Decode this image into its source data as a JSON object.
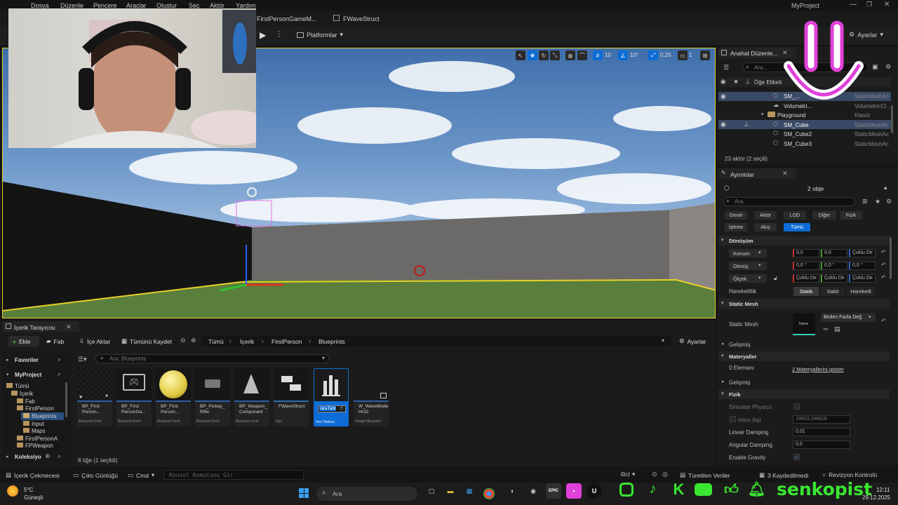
{
  "menu": [
    "Dosya",
    "Düzenle",
    "Pencere",
    "Araçlar",
    "Oluştur",
    "Seç",
    "Aktör",
    "Yardım"
  ],
  "project_name": "MyProject",
  "editor_tabs": [
    "FirstPersonGameM...",
    "FWaveStruct"
  ],
  "toolbar": {
    "platforms": "Platformlar",
    "settings": "Ayarlar"
  },
  "viewport": {
    "grid_value": "10",
    "angle_value": "10°",
    "scale_value": "0,25",
    "camera_value": "1"
  },
  "outliner": {
    "title": "Anahat Düzenle...",
    "search_placeholder": "Ara...",
    "col_label": "Öğe Etiketi",
    "rows": [
      {
        "name": "SM_...",
        "type": "StaticMeshAc"
      },
      {
        "name": "Volumetri...",
        "type": "VolumetricCl..."
      },
      {
        "name": "Playground",
        "type": "Klasör"
      },
      {
        "name": "SM_Cube",
        "type": "StaticMeshAc"
      },
      {
        "name": "SM_Cube2",
        "type": "StaticMeshAc"
      },
      {
        "name": "SM_Cube3",
        "type": "StaticMeshAc"
      }
    ],
    "status": "23 aktör (2 seçili)"
  },
  "details": {
    "title": "Ayrıntılar",
    "objects": "2 obje",
    "search_placeholder": "Ara",
    "filters_row1": [
      "Genel",
      "Aktör",
      "LOD",
      "Diğer",
      "Fizik"
    ],
    "filters_row2": [
      "İşleme",
      "Akış",
      "Tümü"
    ],
    "transform": "Dönüşüm",
    "location": "Konum",
    "rotation": "Dönüş",
    "scale": "Ölçek",
    "loc_vals": [
      "0,0",
      "0,0",
      "Çoklu De"
    ],
    "rot_vals": [
      "0,0 °",
      "0,0 °",
      "0,0 °"
    ],
    "scale_vals": [
      "Çoklu De",
      "Çoklu De",
      "Çoklu De"
    ],
    "mobility_label": "Hareketlilik",
    "mobility": [
      "Statik",
      "Sabit",
      "Hareketli"
    ],
    "static_mesh_header": "Static Mesh",
    "static_mesh_label": "Static Mesh",
    "mesh_thumb": "None",
    "mesh_value": "Birden Fazla Değ",
    "advanced1": "Gelişmiş",
    "materials_header": "Materyaller",
    "elements": "0 Elemanı",
    "show_materials": "2 Materyallerini göster",
    "advanced2": "Gelişmiş",
    "physics_header": "Fizik",
    "simulate": "Simulate Physics",
    "mass_label": "Mass (kg)",
    "mass_value": "19603,298828",
    "linear_label": "Linear Damping",
    "linear_value": "0,01",
    "angular_label": "Angular Damping",
    "angular_value": "0,0",
    "gravity_label": "Enable Gravity"
  },
  "content": {
    "tab": "İçerik Tarayıcısı",
    "add": "Ekle",
    "fab": "Fab",
    "import": "İçe Aktar",
    "save_all": "Tümünü Kaydet",
    "breadcrumb": [
      "Tümü",
      "İçerik",
      "FirstPerson",
      "Blueprints"
    ],
    "settings": "Ayarlar",
    "favorites": "Favoriler",
    "project": "MyProject",
    "search_placeholder": "Ara: Blueprints",
    "tree": [
      "Tümü",
      "İçerik",
      "Fab",
      "FirstPerson",
      "Blueprints",
      "Input",
      "Maps",
      "FirstPersonA",
      "FPWeapon"
    ],
    "collections": "Koleksiyo",
    "assets": [
      {
        "name": "BP_First Person...",
        "type": "Blueprint Sınıfı"
      },
      {
        "name": "BP_First PersonGa...",
        "type": "Blueprint Sınıfı"
      },
      {
        "name": "BP_First Person...",
        "type": "Blueprint Sınıfı"
      },
      {
        "name": "BP_Pickup_ Rifle",
        "type": "Blueprint Sınıfı"
      },
      {
        "name": "BP_Weapon_ Component",
        "type": "Blueprint Sınıfı"
      },
      {
        "name": "FWaveStruct",
        "type": "Yapı"
      },
      {
        "name": "lataTabl",
        "type": "Veri Tablosu"
      },
      {
        "name": "W_WaveMode HUD",
        "type": "Widget Blueprint"
      }
    ],
    "count": "8 öğe (1 seçildi)"
  },
  "statusbar": {
    "drawer": "İçerik Çekmecesi",
    "output": "Çıktı Günlüğü",
    "cmd": "Cmd",
    "console_placeholder": "Konsol Komutunu Gir",
    "derived": "Türetilen Veriler",
    "saved": "3 Kaydedilmedi",
    "revision": "Revizyon Kontrolü"
  },
  "taskbar": {
    "temp": "5°C",
    "weather": "Güneşli",
    "search": "Ara",
    "time": "12:11",
    "date": "29.12.2025",
    "brand": "senkopist"
  },
  "colors": {
    "accent": "#0d6cd6",
    "selection_yellow": "#e8d02a",
    "social_green": "#39e630",
    "logo_pink": "#e040d8"
  }
}
